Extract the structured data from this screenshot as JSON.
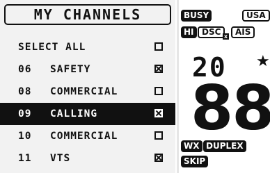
{
  "menu": {
    "title": "MY CHANNELS",
    "select_all": {
      "label": "SELECT ALL",
      "checked": false
    },
    "channels": [
      {
        "number": "06",
        "name": "SAFETY",
        "checked": true,
        "selected": false
      },
      {
        "number": "08",
        "name": "COMMERCIAL",
        "checked": false,
        "selected": false
      },
      {
        "number": "09",
        "name": "CALLING",
        "checked": true,
        "selected": true
      },
      {
        "number": "10",
        "name": "COMMERCIAL",
        "checked": false,
        "selected": false
      },
      {
        "number": "11",
        "name": "VTS",
        "checked": true,
        "selected": false
      }
    ]
  },
  "status": {
    "busy": "BUSY",
    "region": "USA",
    "power": "HI",
    "dsc": "DSC",
    "dsc_mark": "x",
    "ais": "AIS",
    "channel_small": "20",
    "favorite_icon": "star-icon",
    "channel_big": "88",
    "wx": "WX",
    "duplex": "DUPLEX",
    "skip": "SKIP"
  },
  "colors": {
    "background": "#ffffff",
    "panel": "#f2f2f2",
    "ink": "#111111",
    "highlight": "#111111"
  }
}
